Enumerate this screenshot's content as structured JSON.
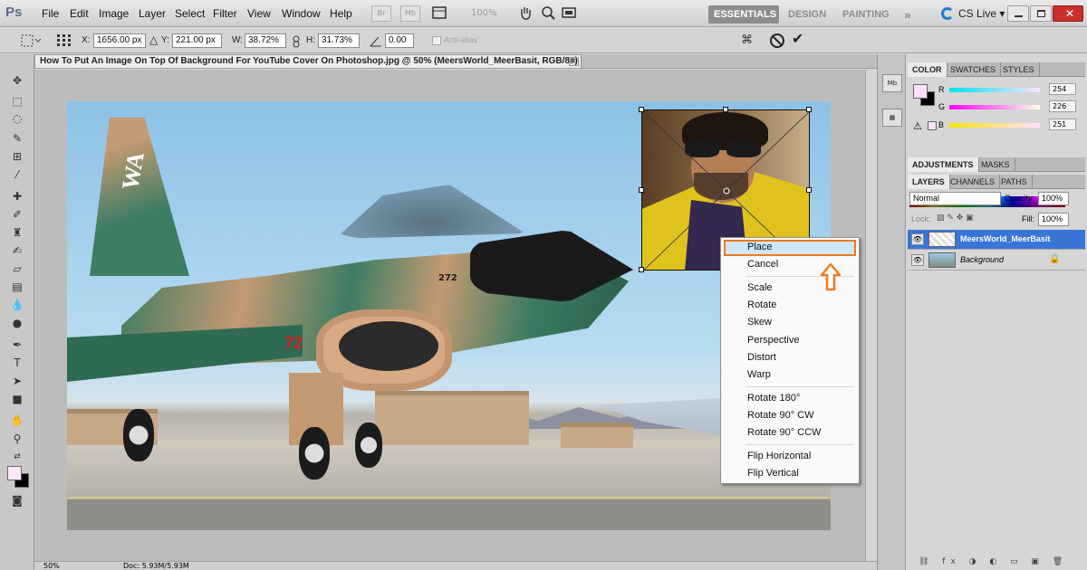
{
  "app": {
    "logo": "Ps"
  },
  "menu": [
    "File",
    "Edit",
    "Image",
    "Layer",
    "Select",
    "Filter",
    "View",
    "Window",
    "Help"
  ],
  "menubar": {
    "br_label": "Br",
    "mb_label": "Mb",
    "zoom": "100%",
    "workspaces": [
      "ESSENTIALS",
      "DESIGN",
      "PAINTING"
    ],
    "more": "»",
    "cs_live": "CS Live ▾"
  },
  "options": {
    "x_label": "X:",
    "x_value": "1656.00 px",
    "y_label": "Y:",
    "y_value": "221.00 px",
    "w_label": "W:",
    "w_value": "38.72%",
    "h_label": "H:",
    "h_value": "31.73%",
    "angle_value": "0.00",
    "antialias_label": "Anti-alias"
  },
  "document": {
    "tab_title": "How To Put An Image On Top Of Background For YouTube Cover On Photoshop.jpg @ 50% (MeersWorld_MeerBasit, RGB/8#)",
    "close": "×",
    "status_zoom": "50%",
    "status_doc": "Doc: 5.93M/5.93M",
    "tail_text": "WA",
    "tail_number": "72",
    "nose_number": "272"
  },
  "context_menu": {
    "items": [
      "Place",
      "Cancel",
      "Scale",
      "Rotate",
      "Skew",
      "Perspective",
      "Distort",
      "Warp",
      "Rotate 180°",
      "Rotate 90° CW",
      "Rotate 90° CCW",
      "Flip Horizontal",
      "Flip Vertical"
    ],
    "highlighted": "Place",
    "highlight_color": "#ee7a1e"
  },
  "panels": {
    "color_tabs": [
      "COLOR",
      "SWATCHES",
      "STYLES"
    ],
    "r_label": "R",
    "r_value": "254",
    "g_label": "G",
    "g_value": "226",
    "b_label": "B",
    "b_value": "251",
    "foreground_color": "#fee2fb",
    "adjust_tabs": [
      "ADJUSTMENTS",
      "MASKS"
    ],
    "layer_tabs": [
      "LAYERS",
      "CHANNELS",
      "PATHS"
    ],
    "blend_mode": "Normal",
    "opacity_label": "Opacity:",
    "opacity_value": "100%",
    "lock_label": "Lock:",
    "fill_label": "Fill:",
    "fill_value": "100%",
    "layers": [
      {
        "name": "MeersWorld_MeerBasit",
        "selected": true
      },
      {
        "name": "Background",
        "selected": false
      }
    ],
    "mini_mb": "Mb"
  }
}
